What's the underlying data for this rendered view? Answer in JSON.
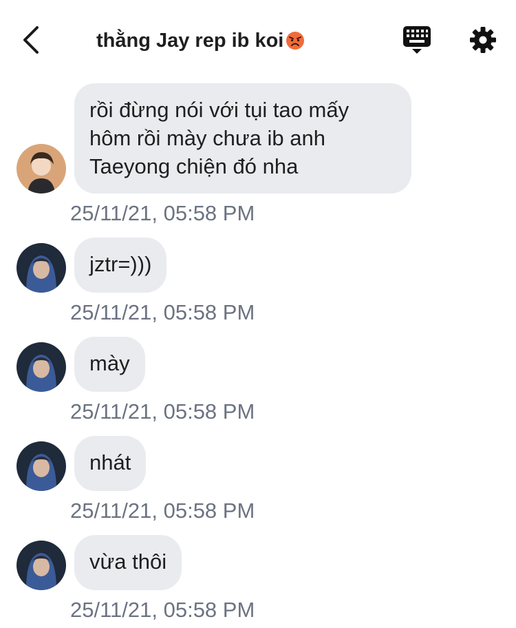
{
  "header": {
    "title": "thằng Jay rep ib koi",
    "title_emoji": "angry-face-emoji",
    "back_icon": "chevron-left-icon",
    "keyboard_icon": "keyboard-icon",
    "settings_icon": "gear-icon"
  },
  "colors": {
    "bubble_background": "#e9ebef",
    "timestamp_text": "#6b7382",
    "title_text": "#1f1f1f",
    "avatar_1_background": "#d9a578",
    "avatar_2_background": "#1f2a3a"
  },
  "messages": [
    {
      "avatar": "avatar-blonde-person",
      "text": "rồi đừng nói với tụi tao mấy hôm rồi mày chưa ib anh Taeyong chiện đó nha",
      "line1": "rồi đừng nói với tụi tao mấy",
      "line2": "hôm rồi mày chưa ib anh",
      "line3": "Taeyong chiện đó nha",
      "timestamp": "25/11/21, 05:58 PM"
    },
    {
      "avatar": "avatar-hooded-person",
      "text": "jztr=)))",
      "timestamp": "25/11/21, 05:58 PM"
    },
    {
      "avatar": "avatar-hooded-person",
      "text": "mày",
      "timestamp": "25/11/21, 05:58 PM"
    },
    {
      "avatar": "avatar-hooded-person",
      "text": "nhát",
      "timestamp": "25/11/21, 05:58 PM"
    },
    {
      "avatar": "avatar-hooded-person",
      "text": "vừa thôi",
      "timestamp": "25/11/21, 05:58 PM"
    }
  ]
}
